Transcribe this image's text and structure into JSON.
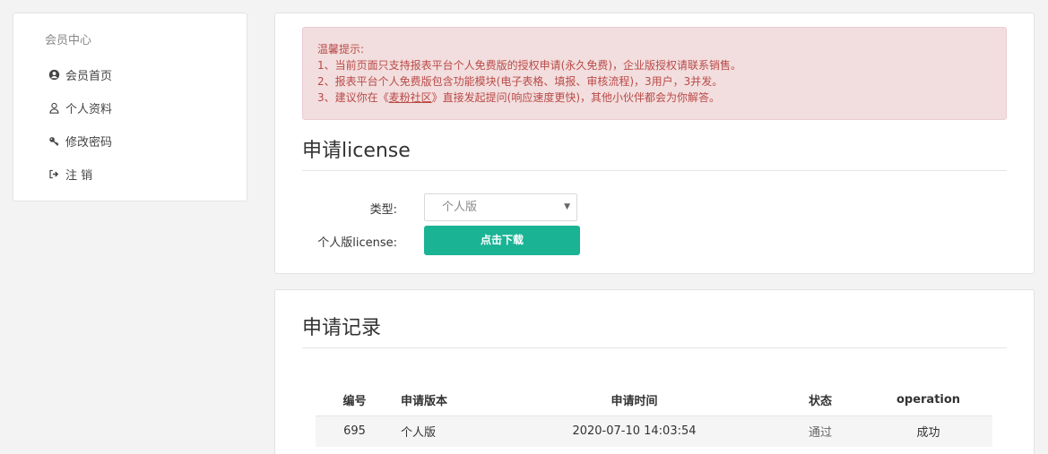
{
  "sidebar": {
    "title": "会员中心",
    "items": [
      {
        "label": "会员首页",
        "icon": "user-circle-icon"
      },
      {
        "label": "个人资料",
        "icon": "user-icon"
      },
      {
        "label": "修改密码",
        "icon": "key-icon"
      },
      {
        "label": "注 销",
        "icon": "sign-out-icon"
      }
    ]
  },
  "notice": {
    "title": "温馨提示:",
    "line1": "1、当前页面只支持报表平台个人免费版的授权申请(永久免费)，企业版授权请联系销售。",
    "line2": "2、报表平台个人免费版包含功能模块(电子表格、填报、审核流程)，3用户，3并发。",
    "line3_prefix": "3、建议你在《",
    "line3_link": "麦粉社区",
    "line3_suffix": "》直接发起提问(响应速度更快)，其他小伙伴都会为你解答。"
  },
  "apply": {
    "title": "申请license",
    "type_label": "类型:",
    "type_value": "个人版",
    "license_label": "个人版license:",
    "download_button": "点击下载"
  },
  "records": {
    "title": "申请记录",
    "columns": [
      "编号",
      "申请版本",
      "申请时间",
      "状态",
      "operation"
    ],
    "rows": [
      {
        "id": "695",
        "version": "个人版",
        "time": "2020-07-10 14:03:54",
        "status": "通过",
        "operation": "成功"
      }
    ]
  },
  "colors": {
    "accent": "#1ab394",
    "alert_bg": "#f2dede",
    "alert_text": "#b94a48"
  }
}
